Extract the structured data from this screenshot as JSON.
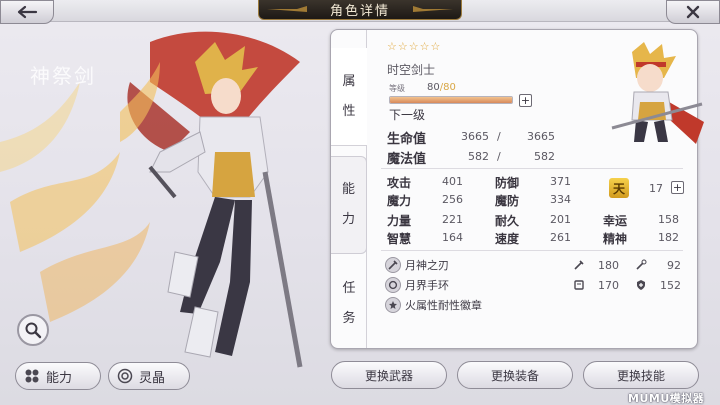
{
  "header": {
    "title": "角色详情"
  },
  "art": {
    "name_watermark": "神祭剑"
  },
  "left_buttons": {
    "ability": "能力",
    "spirit": "灵晶"
  },
  "tabs": {
    "attributes": [
      "属",
      "性"
    ],
    "abilities": [
      "能",
      "力"
    ],
    "missions": [
      "任",
      "务"
    ]
  },
  "character": {
    "stars": "☆☆☆☆☆",
    "class_name": "时空剑士",
    "level_label": "等级",
    "level_current": "80",
    "level_sep": "/",
    "level_max": "80",
    "level_progress": 1.0,
    "next_level_label": "下一级",
    "hp": {
      "label": "生命值",
      "current": "3665",
      "sep": "/",
      "max": "3665"
    },
    "mp": {
      "label": "魔法值",
      "current": "582",
      "sep": "/",
      "max": "582"
    }
  },
  "stats": {
    "attack": {
      "label": "攻击",
      "value": "401"
    },
    "defense": {
      "label": "防御",
      "value": "371"
    },
    "magic": {
      "label": "魔力",
      "value": "256"
    },
    "magic_def": {
      "label": "魔防",
      "value": "334"
    },
    "strength": {
      "label": "力量",
      "value": "221"
    },
    "endurance": {
      "label": "耐久",
      "value": "201"
    },
    "luck": {
      "label": "幸运",
      "value": "158"
    },
    "wisdom": {
      "label": "智慧",
      "value": "164"
    },
    "speed": {
      "label": "速度",
      "value": "261"
    },
    "spirit": {
      "label": "精神",
      "value": "182"
    },
    "sky_badge": "天",
    "sky_value": "17"
  },
  "equipment": [
    {
      "name": "月神之刃",
      "icon": "sword-icon"
    },
    {
      "name": "月界手环",
      "icon": "bracelet-icon"
    },
    {
      "name": "火属性耐性徽章",
      "icon": "badge-icon"
    }
  ],
  "equip_stats": {
    "atk": "180",
    "matk": "92",
    "def": "170",
    "mdef": "152"
  },
  "bottom_buttons": {
    "weapon": "更换武器",
    "gear": "更换装备",
    "skill": "更换技能"
  },
  "brand": "MUMU模拟器"
}
